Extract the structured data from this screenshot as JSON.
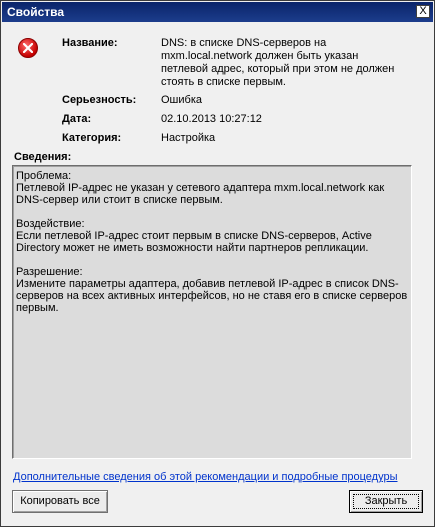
{
  "window": {
    "title": "Свойства",
    "close_glyph": "X"
  },
  "fields": {
    "name_label": "Название:",
    "name_value": "DNS: в списке DNS-серверов на mxm.local.network должен быть указан петлевой адрес, который при этом не должен стоять в списке первым.",
    "severity_label": "Серьезность:",
    "severity_value": "Ошибка",
    "date_label": "Дата:",
    "date_value": "02.10.2013 10:27:12",
    "category_label": "Категория:",
    "category_value": "Настройка"
  },
  "details": {
    "title": "Сведения:",
    "problem": "Проблема:\nПетлевой IP-адрес не указан у сетевого адаптера mxm.local.network как DNS-сервер или стоит в списке первым.",
    "impact": "Воздействие:\nЕсли петлевой IP-адрес стоит первым в списке DNS-серверов, Active Directory может не иметь возможности найти партнеров репликации.",
    "resolution": "Разрешение:\nИзмените параметры адаптера, добавив петлевой IP-адрес в список DNS-серверов на всех активных интерфейсов, но не ставя его в списке серверов первым."
  },
  "link_text": "Дополнительные сведения об этой рекомендации и подробные процедуры",
  "buttons": {
    "copy_all": "Копировать все",
    "close": "Закрыть"
  },
  "colors": {
    "title_bar": "#0a246a",
    "error_red": "#c40000",
    "link": "#0033cc"
  }
}
